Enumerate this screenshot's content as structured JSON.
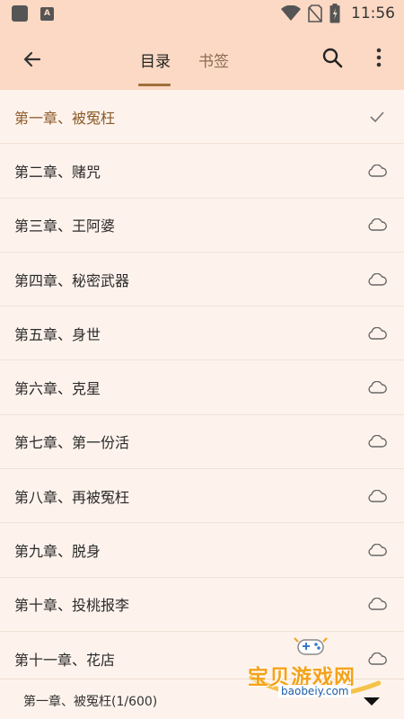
{
  "status_bar": {
    "time": "11:56",
    "icons": [
      "app-icon",
      "a-icon",
      "wifi-icon",
      "no-sim-icon",
      "battery-icon"
    ]
  },
  "header": {
    "back_icon": "arrow-left-icon",
    "tabs": [
      {
        "label": "目录",
        "active": true
      },
      {
        "label": "书签",
        "active": false
      }
    ],
    "search_icon": "search-icon",
    "more_icon": "more-vert-icon"
  },
  "chapters": [
    {
      "title": "第一章、被冤枉",
      "status": "current"
    },
    {
      "title": "第二章、赌咒",
      "status": "cloud"
    },
    {
      "title": "第三章、王阿婆",
      "status": "cloud"
    },
    {
      "title": "第四章、秘密武器",
      "status": "cloud"
    },
    {
      "title": "第五章、身世",
      "status": "cloud"
    },
    {
      "title": "第六章、克星",
      "status": "cloud"
    },
    {
      "title": "第七章、第一份活",
      "status": "cloud"
    },
    {
      "title": "第八章、再被冤枉",
      "status": "cloud"
    },
    {
      "title": "第九章、脱身",
      "status": "cloud"
    },
    {
      "title": "第十章、投桃报李",
      "status": "cloud"
    },
    {
      "title": "第十一章、花店",
      "status": "cloud"
    }
  ],
  "footer": {
    "current_chapter": "第一章、被冤枉(1/600)",
    "scroll_icon": "caret-down-icon"
  },
  "watermark": {
    "text": "宝贝游戏网",
    "url": "baobeiy.com"
  },
  "colors": {
    "header_bg": "#fcd9c4",
    "page_bg": "#fef3ec",
    "accent": "#a0703a",
    "watermark": "#f5a21a"
  }
}
